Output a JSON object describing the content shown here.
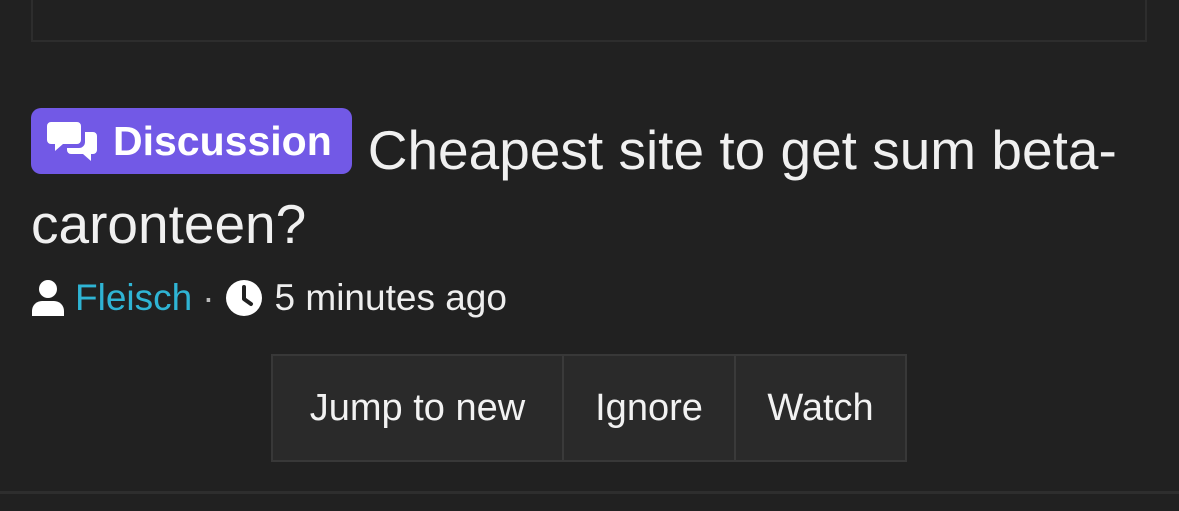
{
  "thread": {
    "prefix_label": "Discussion",
    "title": "Cheapest site to get sum beta-caronteen?",
    "author": "Fleisch",
    "separator": "·",
    "time": "5 minutes ago"
  },
  "actions": {
    "jump_label": "Jump to new",
    "ignore_label": "Ignore",
    "watch_label": "Watch"
  },
  "icons": {
    "prefix_icon": "comments-icon",
    "author_icon": "user-icon",
    "time_icon": "clock-icon"
  },
  "colors": {
    "background": "#212121",
    "prefix_badge": "#7259e6",
    "author_link": "#2fb4d4",
    "button_background": "#2a2a2a"
  }
}
